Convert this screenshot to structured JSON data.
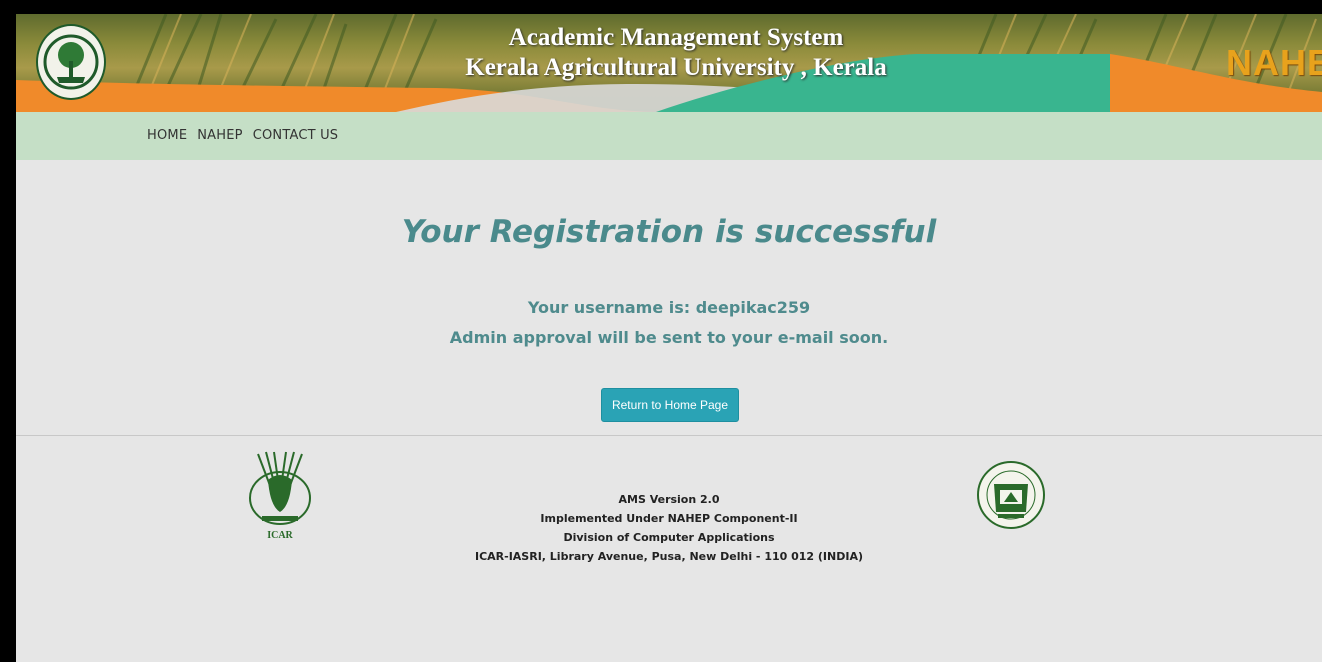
{
  "header": {
    "title": "Academic Management System",
    "subtitle": "Kerala Agricultural University , Kerala",
    "brand_logo_text": "NAHEP",
    "colors": {
      "orange": "#f08a2a",
      "teal": "#39b58f",
      "nav": "#c5dfc6"
    }
  },
  "nav": {
    "items": [
      {
        "label": "HOME"
      },
      {
        "label": "NAHEP"
      },
      {
        "label": "CONTACT US"
      }
    ]
  },
  "main": {
    "heading": "Your Registration is successful",
    "username_line": "Your username is: deepikac259",
    "approval_line": "Admin approval will be sent to your e-mail soon.",
    "return_button_label": "Return to Home Page",
    "accent_color": "#4a8a8c",
    "button_color": "#2aa3b5"
  },
  "footer": {
    "left_logo_label": "ICAR",
    "lines": [
      "AMS Version 2.0",
      "Implemented Under NAHEP Component-II",
      "Division of Computer Applications",
      "ICAR-IASRI, Library Avenue, Pusa, New Delhi - 110 012 (INDIA)"
    ]
  }
}
